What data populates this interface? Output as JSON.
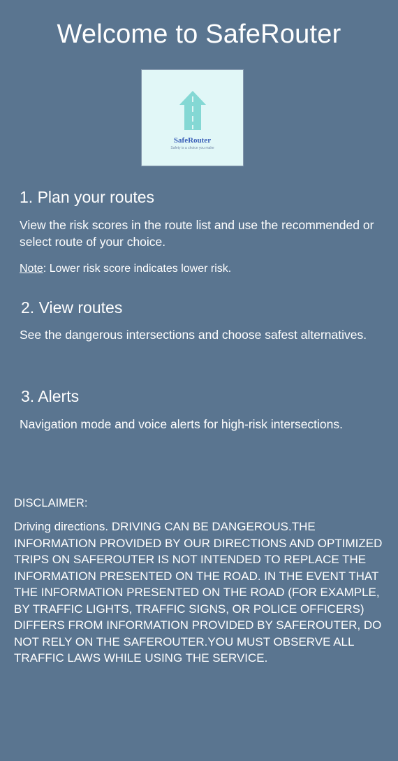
{
  "header": {
    "title": "Welcome to SafeRouter"
  },
  "logo": {
    "name": "SafeRouter",
    "tagline": "Safety is a choice you make",
    "colors": {
      "background": "#e1f7f7",
      "road": "#84d8d4",
      "text": "#3a5fb8"
    }
  },
  "sections": [
    {
      "heading": "1. Plan your routes",
      "body": "View the risk scores in the route list and use the recommended or select route of your choice.",
      "note_label": "Note",
      "note_text": ": Lower risk score indicates lower risk."
    },
    {
      "heading": "2. View routes",
      "body": "See the dangerous intersections and choose safest alternatives."
    },
    {
      "heading": "3. Alerts",
      "body": "Navigation mode and voice alerts for high-risk intersections."
    }
  ],
  "disclaimer": {
    "title": "DISCLAIMER:",
    "text": "Driving directions. DRIVING CAN BE DANGEROUS.THE INFORMATION PROVIDED BY OUR DIRECTIONS AND OPTIMIZED TRIPS ON SAFEROUTER IS NOT INTENDED TO REPLACE THE INFORMATION PRESENTED ON THE ROAD. IN THE EVENT THAT THE INFORMATION PRESENTED ON THE ROAD (FOR EXAMPLE, BY TRAFFIC LIGHTS, TRAFFIC SIGNS, OR POLICE OFFICERS) DIFFERS FROM INFORMATION PROVIDED BY SAFEROUTER, DO NOT RELY ON THE SAFEROUTER.YOU MUST OBSERVE ALL TRAFFIC LAWS WHILE USING THE SERVICE."
  },
  "theme": {
    "background": "#5a7590",
    "text": "#ffffff"
  }
}
